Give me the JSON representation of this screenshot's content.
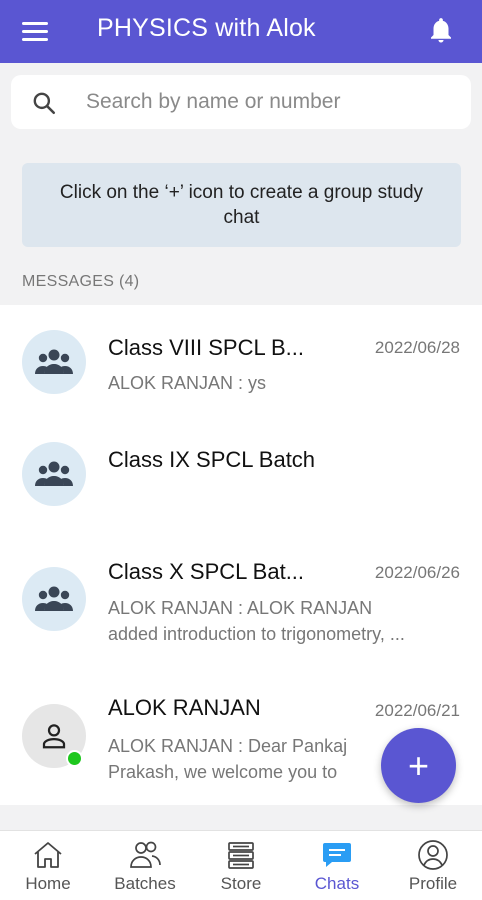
{
  "header": {
    "title": "PHYSICS with Alok",
    "menu_icon": "menu-icon",
    "bell_icon": "bell-icon",
    "background": "#5a56d2"
  },
  "search": {
    "placeholder": "Search by name or number"
  },
  "hint": {
    "text": "Click on the ‘+’ icon to create a group study chat"
  },
  "messages": {
    "label": "MESSAGES (4)",
    "items": [
      {
        "name": "Class VIII SPCL B...",
        "date": "2022/06/28",
        "preview_line1": "ALOK RANJAN :  ys",
        "preview_line2": "",
        "avatar": "group-icon"
      },
      {
        "name": "Class IX SPCL Batch",
        "date": "",
        "preview_line1": "",
        "preview_line2": "",
        "avatar": "group-icon"
      },
      {
        "name": "Class X SPCL Bat...",
        "date": "2022/06/26",
        "preview_line1": "ALOK RANJAN :  ALOK RANJAN",
        "preview_line2": "added introduction to trigonometry, ...",
        "avatar": "group-icon"
      },
      {
        "name": "ALOK RANJAN",
        "date": "2022/06/21",
        "preview_line1": "ALOK RANJAN :  Dear Pankaj",
        "preview_line2": "Prakash, we welcome you to",
        "avatar": "person-icon"
      }
    ]
  },
  "fab": {
    "label": "+"
  },
  "nav": {
    "items": [
      {
        "label": "Home",
        "icon": "home-icon"
      },
      {
        "label": "Batches",
        "icon": "batches-icon"
      },
      {
        "label": "Store",
        "icon": "store-icon"
      },
      {
        "label": "Chats",
        "icon": "chats-icon",
        "active": true
      },
      {
        "label": "Profile",
        "icon": "profile-icon"
      }
    ],
    "active_color": "#5a56d2"
  }
}
